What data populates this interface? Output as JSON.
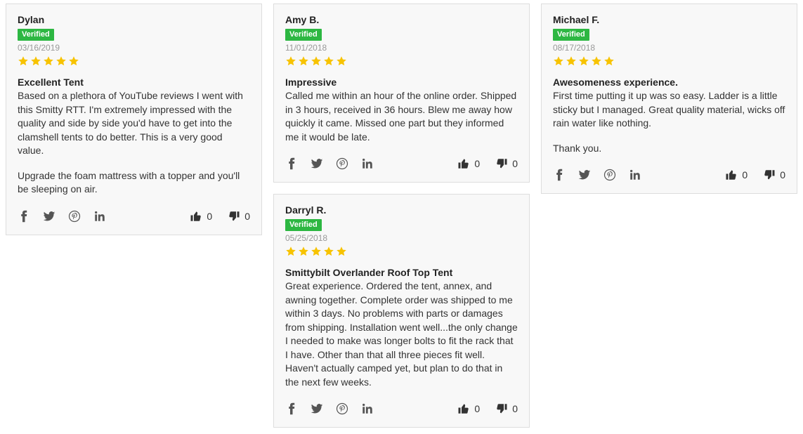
{
  "colors": {
    "verified": "#2db742",
    "star": "#f7c300",
    "card_bg": "#f8f8f8",
    "border": "#dddddd"
  },
  "reviews": [
    {
      "author": "Dylan",
      "badge": "Verified",
      "date": "03/16/2019",
      "rating": 5,
      "title": "Excellent Tent",
      "paragraphs": [
        "Based on a plethora of YouTube reviews I went with this Smitty RTT. I'm extremely impressed with the quality and side by side you'd have to get into the clamshell tents to do better. This is a very good value.",
        "Upgrade the foam mattress with a topper and you'll be sleeping on air."
      ],
      "helpful": "0",
      "unhelpful": "0"
    },
    {
      "author": "Amy B.",
      "badge": "Verified",
      "date": "11/01/2018",
      "rating": 5,
      "title": "Impressive",
      "paragraphs": [
        "Called me within an hour of the online order. Shipped in 3 hours, received in 36 hours. Blew me away how quickly it came. Missed one part but they informed me it would be late."
      ],
      "helpful": "0",
      "unhelpful": "0"
    },
    {
      "author": "Michael F.",
      "badge": "Verified",
      "date": "08/17/2018",
      "rating": 5,
      "title": "Awesomeness experience.",
      "paragraphs": [
        "First time putting it up was so easy. Ladder is a little sticky but I managed. Great quality material, wicks off rain water like nothing.",
        "Thank you."
      ],
      "helpful": "0",
      "unhelpful": "0"
    },
    {
      "author": "Darryl R.",
      "badge": "Verified",
      "date": "05/25/2018",
      "rating": 5,
      "title": "Smittybilt Overlander Roof Top Tent",
      "paragraphs": [
        "Great experience. Ordered the tent, annex, and awning together. Complete order was shipped to me within 3 days. No problems with parts or damages from shipping. Installation went well...the only change I needed to make was longer bolts to fit the rack that I have. Other than that all three pieces fit well. Haven't actually camped yet, but plan to do that in the next few weeks."
      ],
      "helpful": "0",
      "unhelpful": "0"
    }
  ]
}
